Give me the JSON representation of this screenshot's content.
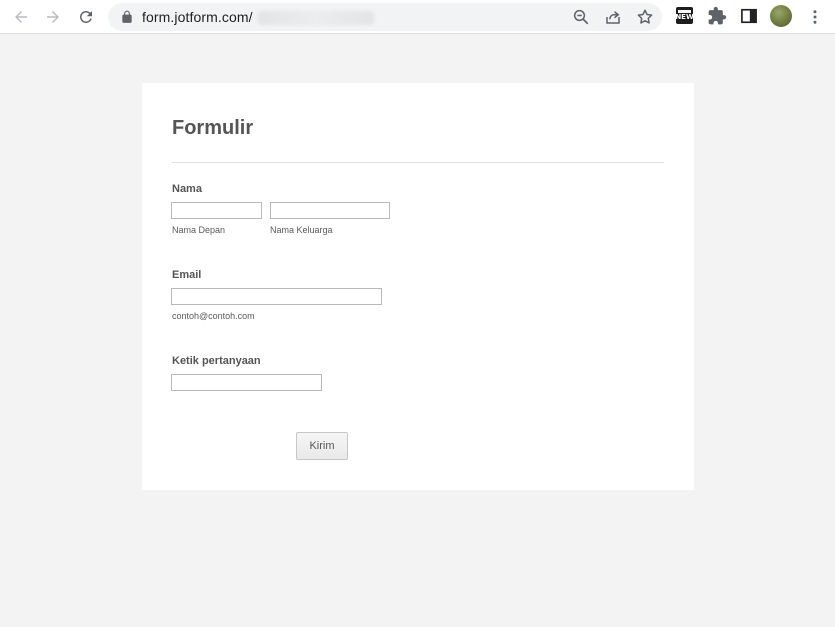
{
  "browser": {
    "url": "form.jotform.com/",
    "news_badge": "NEW"
  },
  "form": {
    "title": "Formulir",
    "name_field": {
      "label": "Nama",
      "first_sublabel": "Nama Depan",
      "last_sublabel": "Nama Keluarga",
      "first_value": "",
      "last_value": ""
    },
    "email_field": {
      "label": "Email",
      "value": "",
      "sublabel": "contoh@contoh.com"
    },
    "question_field": {
      "label": "Ketik pertanyaan",
      "value": ""
    },
    "submit_label": "Kirim"
  }
}
